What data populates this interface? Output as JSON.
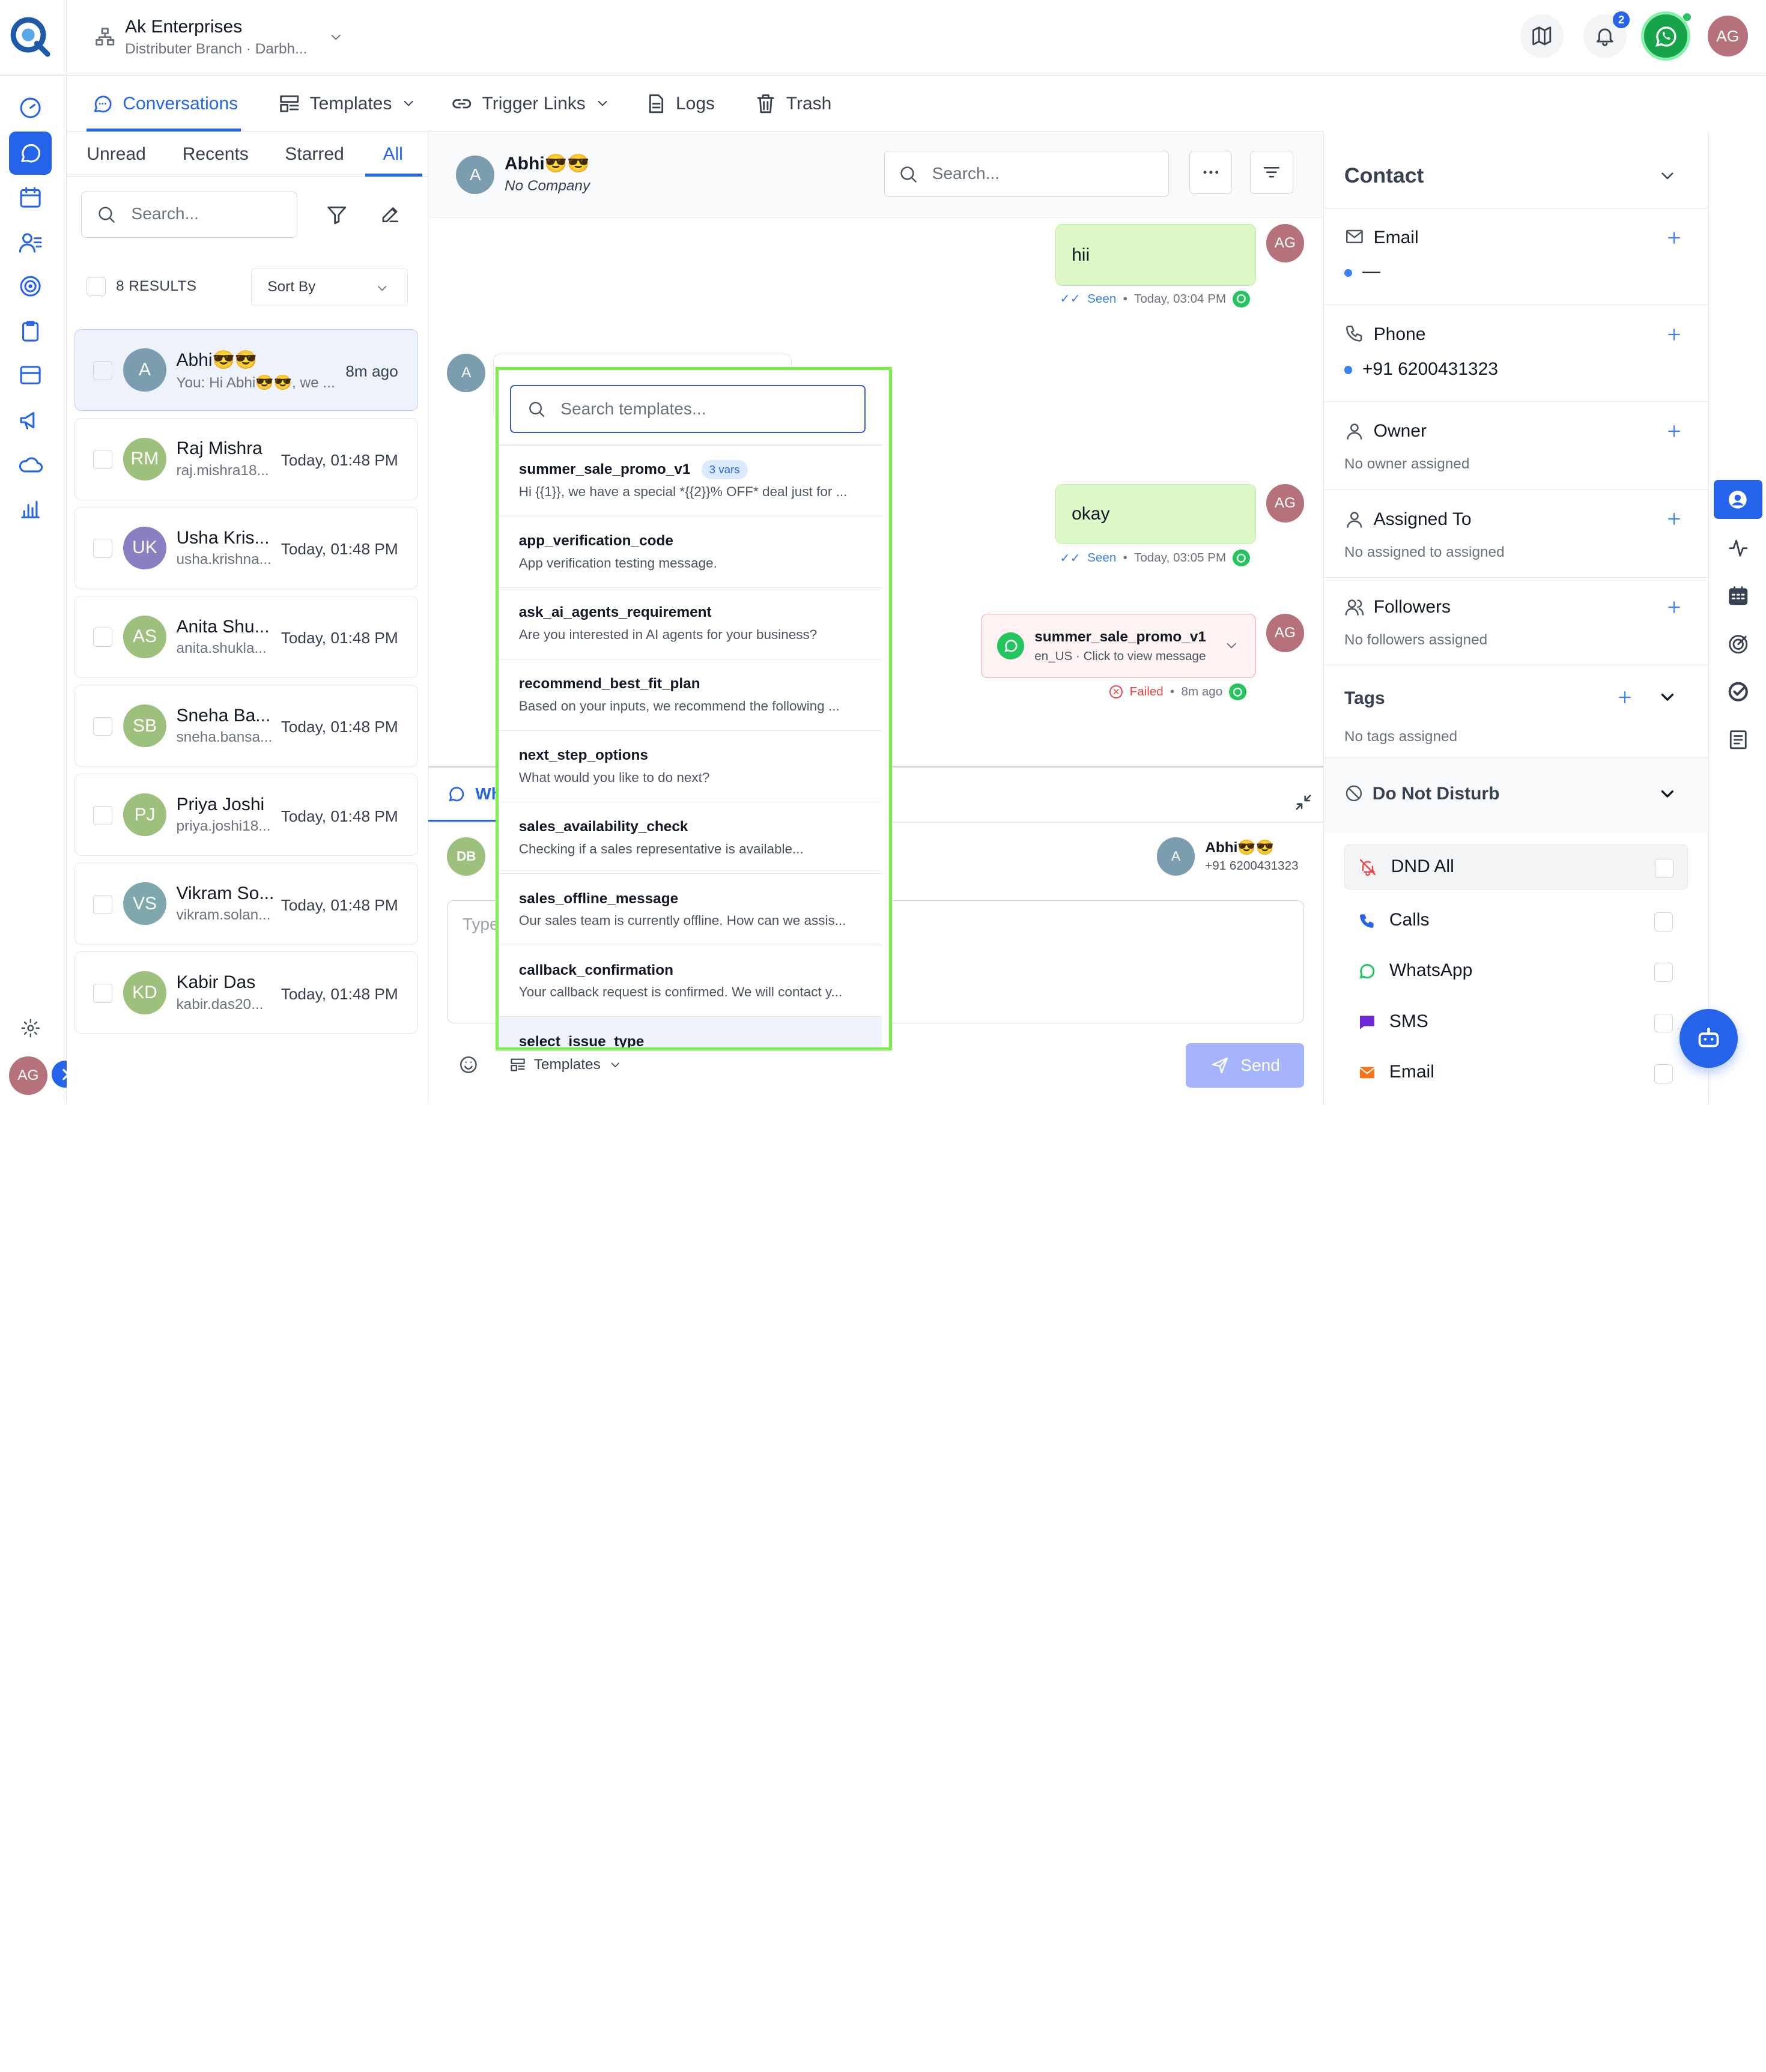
{
  "org": {
    "name": "Ak Enterprises",
    "branch": "Distributer Branch · Darbh..."
  },
  "header": {
    "notif_count": "2",
    "user_initials": "AG"
  },
  "main_tabs": [
    {
      "label": "Conversations"
    },
    {
      "label": "Templates"
    },
    {
      "label": "Trigger Links"
    },
    {
      "label": "Logs"
    },
    {
      "label": "Trash"
    }
  ],
  "filters": {
    "tabs": [
      "Unread",
      "Recents",
      "Starred",
      "All"
    ],
    "active": "All"
  },
  "list": {
    "search_placeholder": "Search...",
    "results": "8 RESULTS",
    "sort_label": "Sort By",
    "conversations": [
      {
        "initials": "A",
        "name": "Abhi😎😎",
        "sub": "You: Hi Abhi😎😎, we ...",
        "time": "8m ago",
        "color": "#7c9cb0"
      },
      {
        "initials": "RM",
        "name": "Raj Mishra",
        "sub": "raj.mishra18...",
        "time": "Today, 01:48 PM",
        "color": "#9dc07d"
      },
      {
        "initials": "UK",
        "name": "Usha Kris...",
        "sub": "usha.krishna...",
        "time": "Today, 01:48 PM",
        "color": "#8c7fc1"
      },
      {
        "initials": "AS",
        "name": "Anita Shu...",
        "sub": "anita.shukla...",
        "time": "Today, 01:48 PM",
        "color": "#9dc07d"
      },
      {
        "initials": "SB",
        "name": "Sneha Ba...",
        "sub": "sneha.bansa...",
        "time": "Today, 01:48 PM",
        "color": "#9dc07d"
      },
      {
        "initials": "PJ",
        "name": "Priya Joshi",
        "sub": "priya.joshi18...",
        "time": "Today, 01:48 PM",
        "color": "#9dc07d"
      },
      {
        "initials": "VS",
        "name": "Vikram So...",
        "sub": "vikram.solan...",
        "time": "Today, 01:48 PM",
        "color": "#7ea8ad"
      },
      {
        "initials": "KD",
        "name": "Kabir Das",
        "sub": "kabir.das20...",
        "time": "Today, 01:48 PM",
        "color": "#9dc07d"
      }
    ]
  },
  "chat": {
    "contact_initial": "A",
    "contact_name": "Abhi😎😎",
    "company": "No Company",
    "search_placeholder": "Search...",
    "agent_initials": "AG",
    "msg1": {
      "text": "hii",
      "status": "Seen",
      "time": "Today, 03:04 PM"
    },
    "msg2": {
      "text": "okay",
      "status": "Seen",
      "time": "Today, 03:05 PM"
    },
    "msg3": {
      "title": "summer_sale_promo_v1",
      "sub": "en_US · Click to view message",
      "status": "Failed",
      "time": "8m ago"
    },
    "composer": {
      "channel_tab": "WhatsApp",
      "from_initials": "DB",
      "to_initial": "A",
      "to_name": "Abhi😎😎",
      "to_phone": "+91 6200431323",
      "placeholder": "Type a message...",
      "templates_label": "Templates",
      "send_label": "Send"
    }
  },
  "template_dropdown": {
    "search_placeholder": "Search templates...",
    "items": [
      {
        "name": "summer_sale_promo_v1",
        "badge": "3 vars",
        "desc": "Hi {{1}}, we have a special *{{2}}% OFF* deal just for ..."
      },
      {
        "name": "app_verification_code",
        "desc": "App verification testing message."
      },
      {
        "name": "ask_ai_agents_requirement",
        "desc": "Are you interested in AI agents for your business?"
      },
      {
        "name": "recommend_best_fit_plan",
        "desc": "Based on your inputs, we recommend the following ..."
      },
      {
        "name": "next_step_options",
        "desc": "What would you like to do next?"
      },
      {
        "name": "sales_availability_check",
        "desc": "Checking if a sales representative is available..."
      },
      {
        "name": "sales_offline_message",
        "desc": "Our sales team is currently offline. How can we assis..."
      },
      {
        "name": "callback_confirmation",
        "desc": "Your callback request is confirmed. We will contact y..."
      },
      {
        "name": "select_issue_type",
        "desc": ""
      }
    ]
  },
  "contact_panel": {
    "title": "Contact",
    "email_label": "Email",
    "email_value": "—",
    "phone_label": "Phone",
    "phone_value": "+91 6200431323",
    "owner_label": "Owner",
    "owner_empty": "No owner assigned",
    "assigned_label": "Assigned To",
    "assigned_empty": "No assigned to assigned",
    "followers_label": "Followers",
    "followers_empty": "No followers assigned",
    "tags_label": "Tags",
    "tags_empty": "No tags assigned",
    "dnd_label": "Do Not Disturb",
    "dnd_options": [
      "DND All",
      "Calls",
      "WhatsApp",
      "SMS",
      "Email"
    ]
  },
  "colors": {
    "accent": "#2563eb",
    "whatsapp": "#22c55e",
    "bubble": "#dcf8c6",
    "failed": "#ef4444",
    "highlight": "#7cf04a"
  }
}
